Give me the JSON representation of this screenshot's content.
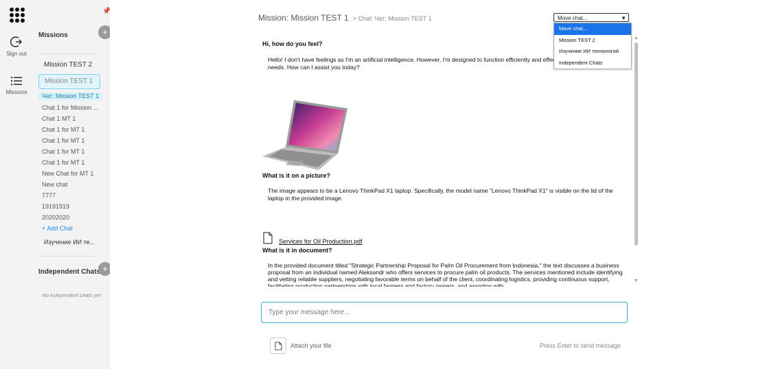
{
  "rail": {
    "sign_out_label": "Sign out",
    "missions_label": "Missions"
  },
  "sidebar": {
    "missions_title": "Missions",
    "add_label": "+",
    "missions": [
      "Mission TEST 2",
      "Mission TEST 1"
    ],
    "chats": [
      "Чат: Mission TEST 1",
      "Chat 1 for Mission ...",
      "Chat 1 MT 1",
      "Chat 1 for MT 1",
      "Chat 1 for MT 1",
      "Chat 1 for MT 1",
      "Chat 1 for MT 1",
      "New Chat for MT 1",
      "New chat",
      "7777",
      "19191919",
      "20202020"
    ],
    "add_chat_label": "+ Add Chat",
    "other_mission": "Изучение ИИ те...",
    "independent_title": "Independent Chats",
    "empty_text": "No independent chats yet"
  },
  "header": {
    "title": "Mission: Mission TEST 1",
    "subtitle": "> Chat: Чат: Mission TEST 1"
  },
  "move_chat": {
    "selected": "Move chat...",
    "options": [
      "Move chat...",
      "Mission TEST 2",
      "Изучение ИИ технологий",
      "Independent Chats"
    ]
  },
  "messages": {
    "q1": "Hi, how do you feel?",
    "a1": "Hello! I don't have feelings as I'm an artificial intelligence. However, I'm designed to function efficiently and effectively to help with your needs. How can I assist you today?",
    "q2": "What is it on a picture?",
    "a2": "The image appears to be a Lenovo ThinkPad X1 laptop. Specifically, the model name \"Lenovo ThinkPad X1\" is visible on the lid of the laptop in the provided image.",
    "file_name": "Services for Oil Production.pdf",
    "q3": "What is it in document?",
    "a3": "In the provided document titled \"Strategic Partnership Proposal for Palm Oil Procurement from Indonesia,\" the text discusses a business proposal from an individual named Aleksandr who offers services to procure palm oil products. The services mentioned include identifying and vetting reliable suppliers, negotiating favorable terms on behalf of the client, coordinating logistics, providing continuous support, facilitating production partnerships with local farmers and factory owners, and assisting with"
  },
  "composer": {
    "placeholder": "Type your message here...",
    "attach_label": "Attach your file",
    "hint": "Press Enter to send message"
  },
  "colors": {
    "accent": "#3aa9d6",
    "selected_option": "#1a73e8",
    "active_chat_bg": "#d6f1fa"
  }
}
